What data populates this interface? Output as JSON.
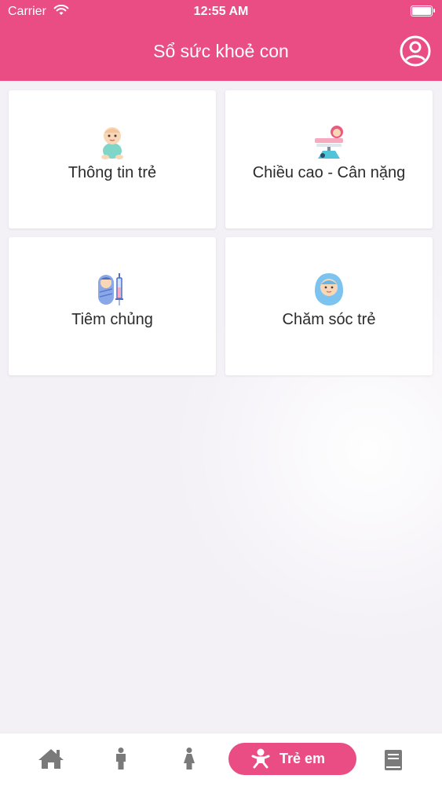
{
  "status_bar": {
    "carrier": "Carrier",
    "time": "12:55 AM"
  },
  "header": {
    "title": "Sổ sức khoẻ con",
    "profile_icon": "user-circle-icon"
  },
  "cards": [
    {
      "label": "Thông tin trẻ",
      "icon": "baby-sitting-icon"
    },
    {
      "label": "Chiều cao - Cân nặng",
      "icon": "baby-scale-icon"
    },
    {
      "label": "Tiêm chủng",
      "icon": "vaccine-syringe-icon"
    },
    {
      "label": "Chăm sóc trẻ",
      "icon": "swaddled-baby-icon"
    }
  ],
  "tabbar": {
    "active_label": "Trẻ em",
    "items": [
      "home-icon",
      "man-icon",
      "woman-icon",
      "baby-icon",
      "book-icon"
    ]
  },
  "colors": {
    "primary": "#ea4c84",
    "background": "#f3f1f6",
    "tab_icon": "#7a7a7a"
  }
}
